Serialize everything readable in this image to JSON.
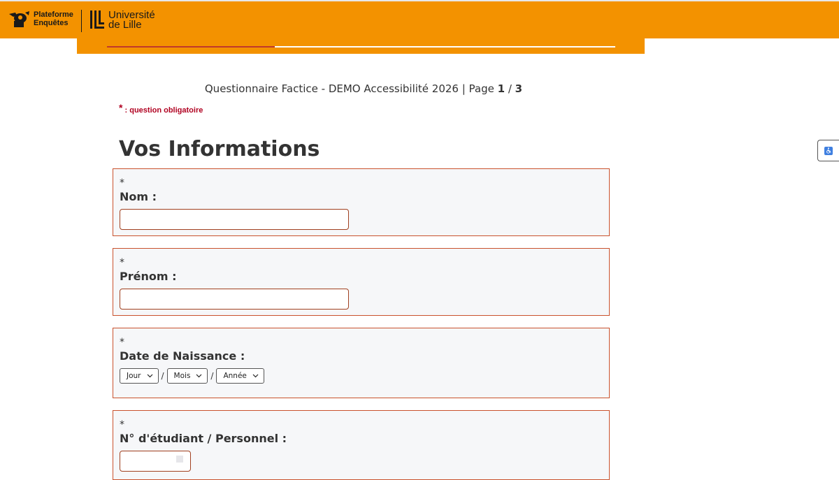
{
  "header": {
    "logo_plateforme_line1": "Plateforme",
    "logo_plateforme_line2": "Enquêtes",
    "logo_university_line1": "Université",
    "logo_university_line2": "de Lille",
    "brand_color": "#f39200"
  },
  "progress": {
    "fraction": 0.33,
    "fill_color": "#c0392b"
  },
  "page": {
    "title_text": "Questionnaire Factice - DEMO Accessibilité 2026 | Page ",
    "page_current": "1",
    "page_sep": " / ",
    "page_total": "3",
    "required_note": ": question obligatoire",
    "required_star": "*"
  },
  "section": {
    "heading": "Vos Informations"
  },
  "questions": [
    {
      "asterisk": "*",
      "label": "Nom :",
      "type": "text",
      "value": ""
    },
    {
      "asterisk": "*",
      "label": "Prénom :",
      "type": "text",
      "value": ""
    },
    {
      "asterisk": "*",
      "label": "Date de Naissance :",
      "type": "date",
      "day_label": "Jour",
      "month_label": "Mois",
      "year_label": "Année",
      "separator": "/"
    },
    {
      "asterisk": "*",
      "label": "N° d'étudiant / Personnel :",
      "type": "number",
      "value": ""
    }
  ],
  "accessibility_button": {
    "icon": "accessibility-icon"
  }
}
